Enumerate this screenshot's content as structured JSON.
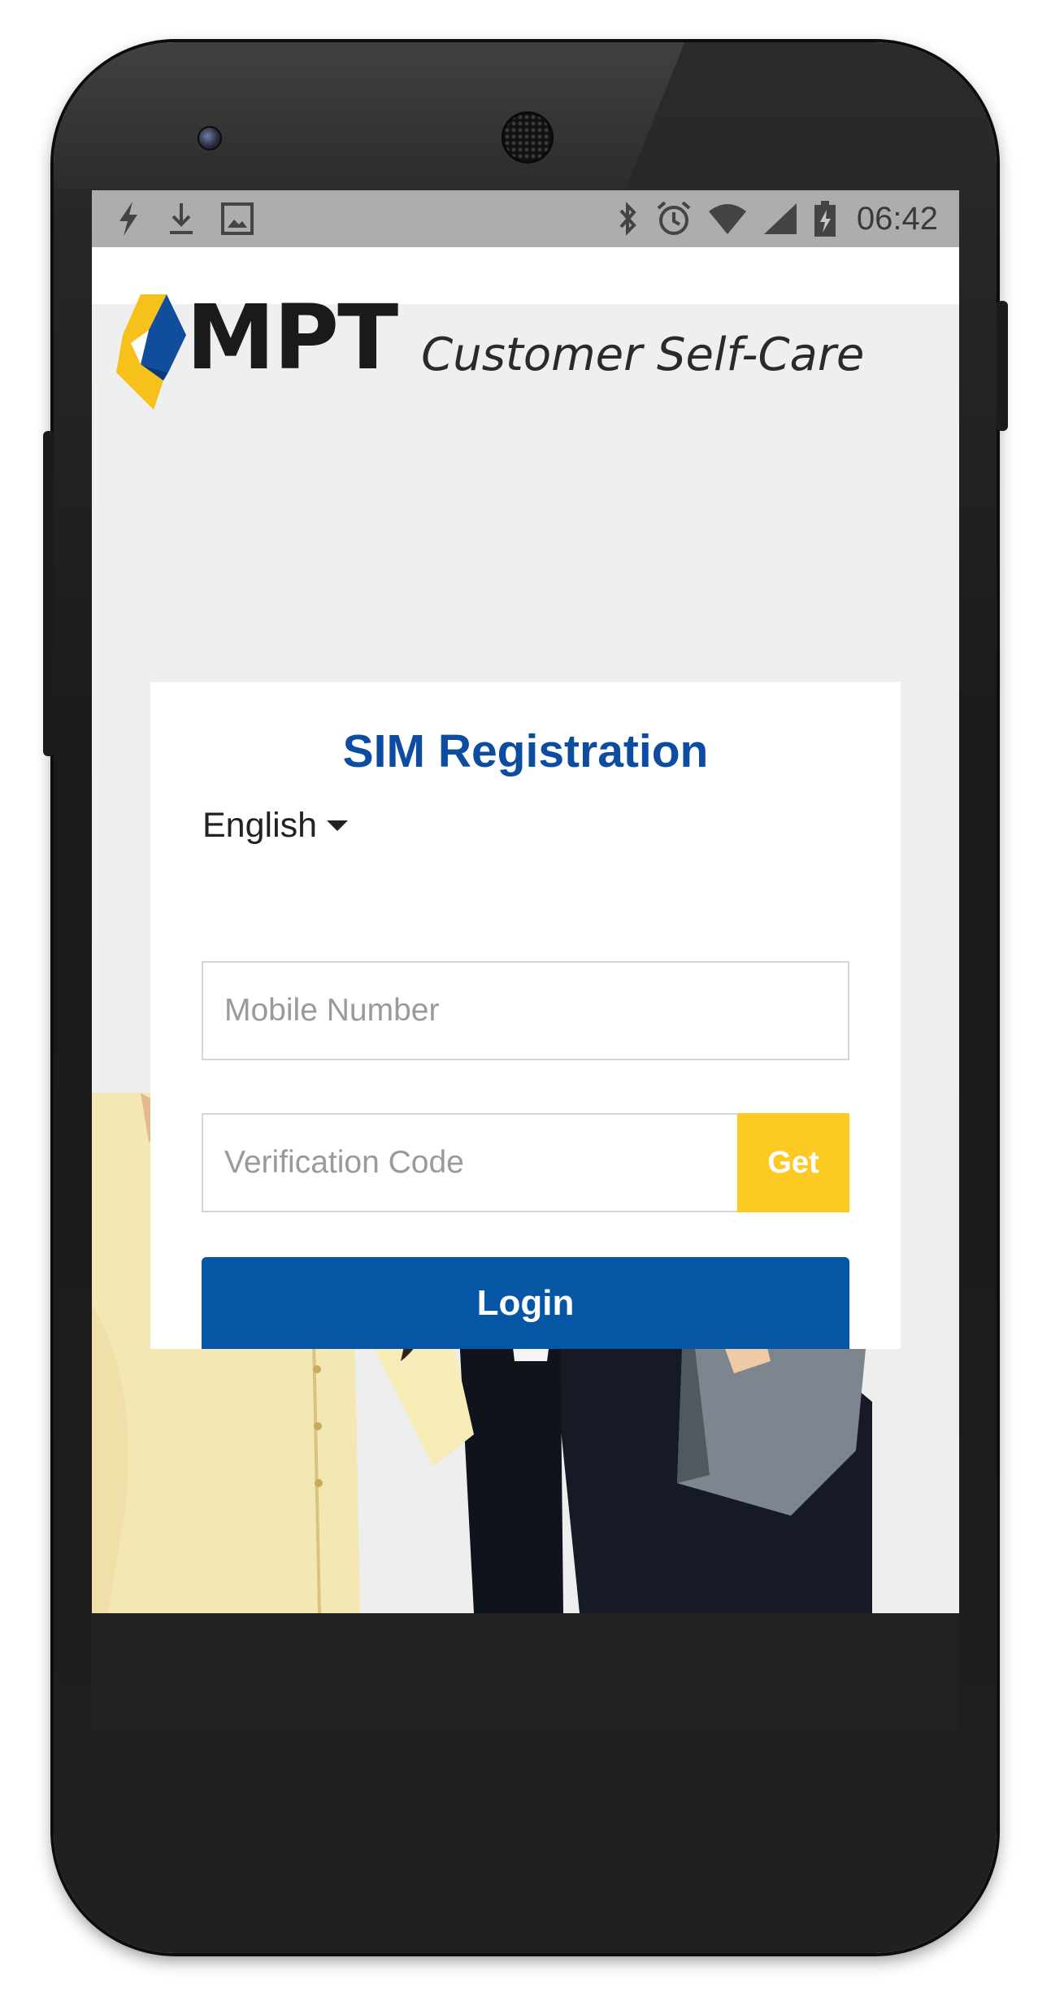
{
  "status_bar": {
    "left_icons": [
      "flash-icon",
      "download-icon",
      "image-icon"
    ],
    "right_icons": [
      "bluetooth-icon",
      "alarm-icon",
      "wifi-icon",
      "signal-icon",
      "battery-charging-icon"
    ],
    "time": "06:42"
  },
  "header": {
    "brand": "MPT",
    "tagline": "Customer Self-Care"
  },
  "card": {
    "title": "SIM Registration",
    "language": "English",
    "mobile_placeholder": "Mobile Number",
    "code_placeholder": "Verification Code",
    "get_label": "Get",
    "login_label": "Login"
  },
  "colors": {
    "brand_blue": "#0c4da2",
    "button_blue": "#0656a6",
    "accent_yellow": "#fdc923",
    "status_bar": "#adadad"
  }
}
